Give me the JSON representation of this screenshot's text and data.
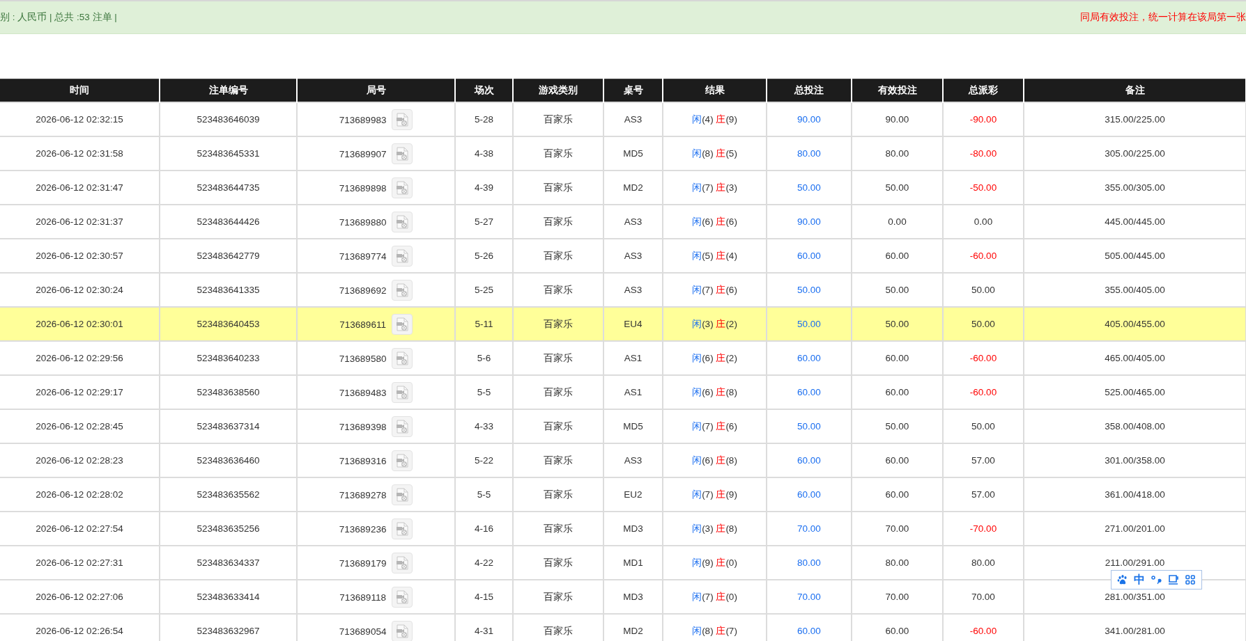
{
  "summary_bar": {
    "left_text": "别 : 人民币 | 总共 :53 注单 |",
    "right_notice": "同局有效投注，统一计算在该局第一张"
  },
  "table": {
    "columns": [
      "时间",
      "注单编号",
      "局号",
      "场次",
      "游戏类别",
      "桌号",
      "结果",
      "总投注",
      "有效投注",
      "总派彩",
      "备注"
    ],
    "rows": [
      {
        "time": "2026-06-12 02:32:15",
        "bet_no": "523483646039",
        "round_no": "713689983",
        "session": "5-28",
        "game": "百家乐",
        "table": "AS3",
        "result": {
          "player_label": "闲",
          "player": "(4)",
          "banker_label": "庄",
          "banker": "(9)"
        },
        "total_bet": "90.00",
        "valid_bet": "90.00",
        "payout": "-90.00",
        "loss": true,
        "remark": "315.00/225.00",
        "highlighted": false
      },
      {
        "time": "2026-06-12 02:31:58",
        "bet_no": "523483645331",
        "round_no": "713689907",
        "session": "4-38",
        "game": "百家乐",
        "table": "MD5",
        "result": {
          "player_label": "闲",
          "player": "(8)",
          "banker_label": "庄",
          "banker": "(5)"
        },
        "total_bet": "80.00",
        "valid_bet": "80.00",
        "payout": "-80.00",
        "loss": true,
        "remark": "305.00/225.00",
        "highlighted": false
      },
      {
        "time": "2026-06-12 02:31:47",
        "bet_no": "523483644735",
        "round_no": "713689898",
        "session": "4-39",
        "game": "百家乐",
        "table": "MD2",
        "result": {
          "player_label": "闲",
          "player": "(7)",
          "banker_label": "庄",
          "banker": "(3)"
        },
        "total_bet": "50.00",
        "valid_bet": "50.00",
        "payout": "-50.00",
        "loss": true,
        "remark": "355.00/305.00",
        "highlighted": false
      },
      {
        "time": "2026-06-12 02:31:37",
        "bet_no": "523483644426",
        "round_no": "713689880",
        "session": "5-27",
        "game": "百家乐",
        "table": "AS3",
        "result": {
          "player_label": "闲",
          "player": "(6)",
          "banker_label": "庄",
          "banker": "(6)"
        },
        "total_bet": "90.00",
        "valid_bet": "0.00",
        "payout": "0.00",
        "loss": false,
        "remark": "445.00/445.00",
        "highlighted": false
      },
      {
        "time": "2026-06-12 02:30:57",
        "bet_no": "523483642779",
        "round_no": "713689774",
        "session": "5-26",
        "game": "百家乐",
        "table": "AS3",
        "result": {
          "player_label": "闲",
          "player": "(5)",
          "banker_label": "庄",
          "banker": "(4)"
        },
        "total_bet": "60.00",
        "valid_bet": "60.00",
        "payout": "-60.00",
        "loss": true,
        "remark": "505.00/445.00",
        "highlighted": false
      },
      {
        "time": "2026-06-12 02:30:24",
        "bet_no": "523483641335",
        "round_no": "713689692",
        "session": "5-25",
        "game": "百家乐",
        "table": "AS3",
        "result": {
          "player_label": "闲",
          "player": "(7)",
          "banker_label": "庄",
          "banker": "(6)"
        },
        "total_bet": "50.00",
        "valid_bet": "50.00",
        "payout": "50.00",
        "loss": false,
        "remark": "355.00/405.00",
        "highlighted": false
      },
      {
        "time": "2026-06-12 02:30:01",
        "bet_no": "523483640453",
        "round_no": "713689611",
        "session": "5-11",
        "game": "百家乐",
        "table": "EU4",
        "result": {
          "player_label": "闲",
          "player": "(3)",
          "banker_label": "庄",
          "banker": "(2)"
        },
        "total_bet": "50.00",
        "valid_bet": "50.00",
        "payout": "50.00",
        "loss": false,
        "remark": "405.00/455.00",
        "highlighted": true
      },
      {
        "time": "2026-06-12 02:29:56",
        "bet_no": "523483640233",
        "round_no": "713689580",
        "session": "5-6",
        "game": "百家乐",
        "table": "AS1",
        "result": {
          "player_label": "闲",
          "player": "(6)",
          "banker_label": "庄",
          "banker": "(2)"
        },
        "total_bet": "60.00",
        "valid_bet": "60.00",
        "payout": "-60.00",
        "loss": true,
        "remark": "465.00/405.00",
        "highlighted": false
      },
      {
        "time": "2026-06-12 02:29:17",
        "bet_no": "523483638560",
        "round_no": "713689483",
        "session": "5-5",
        "game": "百家乐",
        "table": "AS1",
        "result": {
          "player_label": "闲",
          "player": "(6)",
          "banker_label": "庄",
          "banker": "(8)"
        },
        "total_bet": "60.00",
        "valid_bet": "60.00",
        "payout": "-60.00",
        "loss": true,
        "remark": "525.00/465.00",
        "highlighted": false
      },
      {
        "time": "2026-06-12 02:28:45",
        "bet_no": "523483637314",
        "round_no": "713689398",
        "session": "4-33",
        "game": "百家乐",
        "table": "MD5",
        "result": {
          "player_label": "闲",
          "player": "(7)",
          "banker_label": "庄",
          "banker": "(6)"
        },
        "total_bet": "50.00",
        "valid_bet": "50.00",
        "payout": "50.00",
        "loss": false,
        "remark": "358.00/408.00",
        "highlighted": false
      },
      {
        "time": "2026-06-12 02:28:23",
        "bet_no": "523483636460",
        "round_no": "713689316",
        "session": "5-22",
        "game": "百家乐",
        "table": "AS3",
        "result": {
          "player_label": "闲",
          "player": "(6)",
          "banker_label": "庄",
          "banker": "(8)"
        },
        "total_bet": "60.00",
        "valid_bet": "60.00",
        "payout": "57.00",
        "loss": false,
        "remark": "301.00/358.00",
        "highlighted": false
      },
      {
        "time": "2026-06-12 02:28:02",
        "bet_no": "523483635562",
        "round_no": "713689278",
        "session": "5-5",
        "game": "百家乐",
        "table": "EU2",
        "result": {
          "player_label": "闲",
          "player": "(7)",
          "banker_label": "庄",
          "banker": "(9)"
        },
        "total_bet": "60.00",
        "valid_bet": "60.00",
        "payout": "57.00",
        "loss": false,
        "remark": "361.00/418.00",
        "highlighted": false
      },
      {
        "time": "2026-06-12 02:27:54",
        "bet_no": "523483635256",
        "round_no": "713689236",
        "session": "4-16",
        "game": "百家乐",
        "table": "MD3",
        "result": {
          "player_label": "闲",
          "player": "(3)",
          "banker_label": "庄",
          "banker": "(8)"
        },
        "total_bet": "70.00",
        "valid_bet": "70.00",
        "payout": "-70.00",
        "loss": true,
        "remark": "271.00/201.00",
        "highlighted": false
      },
      {
        "time": "2026-06-12 02:27:31",
        "bet_no": "523483634337",
        "round_no": "713689179",
        "session": "4-22",
        "game": "百家乐",
        "table": "MD1",
        "result": {
          "player_label": "闲",
          "player": "(9)",
          "banker_label": "庄",
          "banker": "(0)"
        },
        "total_bet": "80.00",
        "valid_bet": "80.00",
        "payout": "80.00",
        "loss": false,
        "remark": "211.00/291.00",
        "highlighted": false
      },
      {
        "time": "2026-06-12 02:27:06",
        "bet_no": "523483633414",
        "round_no": "713689118",
        "session": "4-15",
        "game": "百家乐",
        "table": "MD3",
        "result": {
          "player_label": "闲",
          "player": "(7)",
          "banker_label": "庄",
          "banker": "(0)"
        },
        "total_bet": "70.00",
        "valid_bet": "70.00",
        "payout": "70.00",
        "loss": false,
        "remark": "281.00/351.00",
        "highlighted": false
      },
      {
        "time": "2026-06-12 02:26:54",
        "bet_no": "523483632967",
        "round_no": "713689054",
        "session": "4-31",
        "game": "百家乐",
        "table": "MD2",
        "result": {
          "player_label": "闲",
          "player": "(8)",
          "banker_label": "庄",
          "banker": "(7)"
        },
        "total_bet": "60.00",
        "valid_bet": "60.00",
        "payout": "-60.00",
        "loss": true,
        "remark": "341.00/281.00",
        "highlighted": false
      }
    ]
  },
  "ime_toolbar": {
    "mode": "中"
  }
}
